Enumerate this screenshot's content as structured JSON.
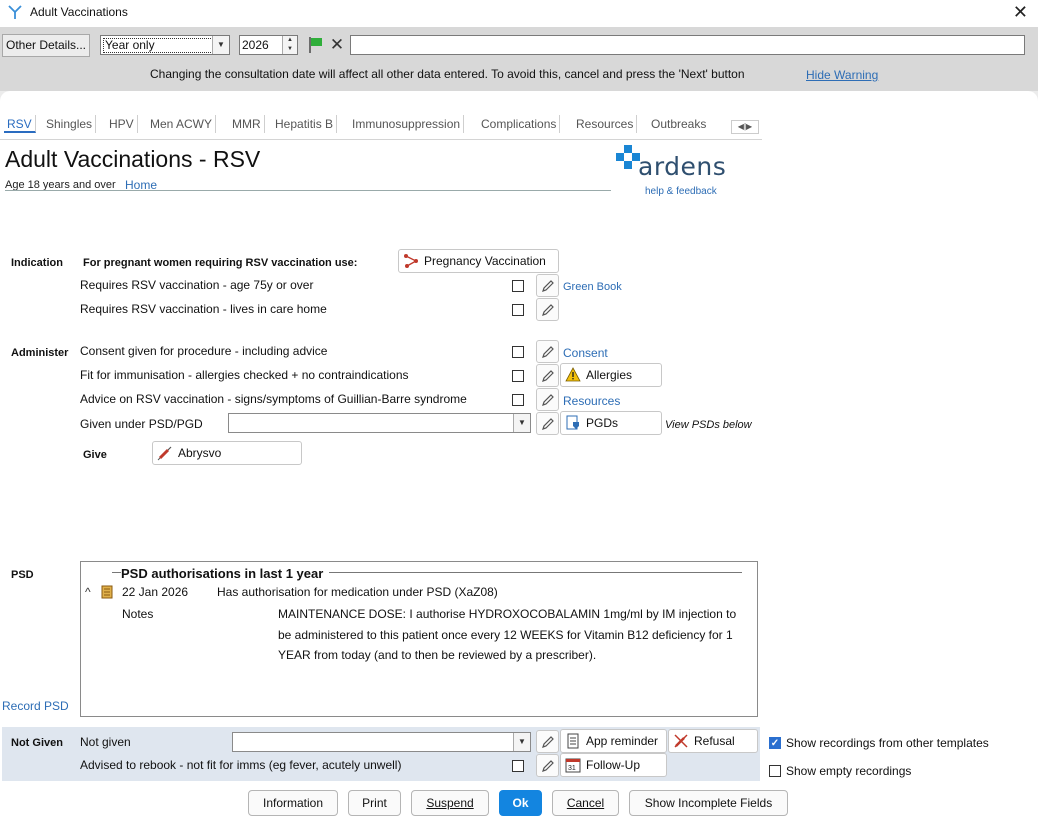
{
  "window": {
    "title": "Adult Vaccinations",
    "close": "✕"
  },
  "toolbar": {
    "other_details": "Other Details...",
    "date_mode": "Year only",
    "year": "2026",
    "warning": "Changing the consultation date will affect all other data entered. To avoid this, cancel and press the 'Next' button",
    "hide_warning": "Hide Warning"
  },
  "tabs": [
    "RSV",
    "Shingles",
    "HPV",
    "Men ACWY",
    "MMR",
    "Hepatitis B",
    "Immunosuppression",
    "Complications",
    "Resources",
    "Outbreaks"
  ],
  "active_tab": "RSV",
  "header": {
    "title": "Adult Vaccinations - RSV",
    "subtitle": "Age 18 years and over",
    "home_link": "Home",
    "brand": "ardens",
    "help": "help & feedback"
  },
  "indication": {
    "label": "Indication",
    "pregnant_text": "For pregnant women requiring RSV vaccination use:",
    "pregnancy_btn": "Pregnancy Vaccination",
    "rows": [
      "Requires RSV vaccination - age 75y or over",
      "Requires RSV vaccination - lives in care home"
    ],
    "green_book": "Green Book"
  },
  "administer": {
    "label": "Administer",
    "rows": [
      "Consent given for procedure - including advice",
      "Fit for immunisation - allergies checked + no contraindications",
      "Advice on RSV vaccination - signs/symptoms of Guillian-Barre syndrome",
      "Given under PSD/PGD"
    ],
    "consent_link": "Consent",
    "allergies_btn": "Allergies",
    "resources_link": "Resources",
    "pgds_btn": "PGDs",
    "view_psds": "View PSDs below",
    "give_label": "Give",
    "give_btn": "Abrysvo"
  },
  "psd": {
    "label": "PSD",
    "heading": "PSD authorisations in last 1 year",
    "date": "22 Jan 2026",
    "description": "Has authorisation for medication under PSD (XaZ08)",
    "notes_label": "Notes",
    "notes": "MAINTENANCE DOSE: I authorise HYDROXOCOBALAMIN 1mg/ml by IM injection to be administered to this patient once every 12 WEEKS for Vitamin B12 deficiency for 1 YEAR from today (and to then be reviewed by a prescriber).",
    "record_psd": "Record PSD"
  },
  "not_given": {
    "label": "Not Given",
    "row1": "Not given",
    "row2": "Advised to rebook - not fit for imms (eg fever, acutely unwell)",
    "app_reminder": "App reminder",
    "refusal": "Refusal",
    "follow_up": "Follow-Up"
  },
  "options": {
    "show_other_templates": "Show recordings from other templates",
    "show_empty": "Show empty recordings"
  },
  "footer": {
    "information": "Information",
    "print": "Print",
    "suspend": "Suspend",
    "ok": "Ok",
    "cancel": "Cancel",
    "show_incomplete": "Show Incomplete Fields"
  },
  "colors": {
    "accent": "#1385e0",
    "link": "#2d6db5",
    "brand_cross": "#1a86d4"
  }
}
